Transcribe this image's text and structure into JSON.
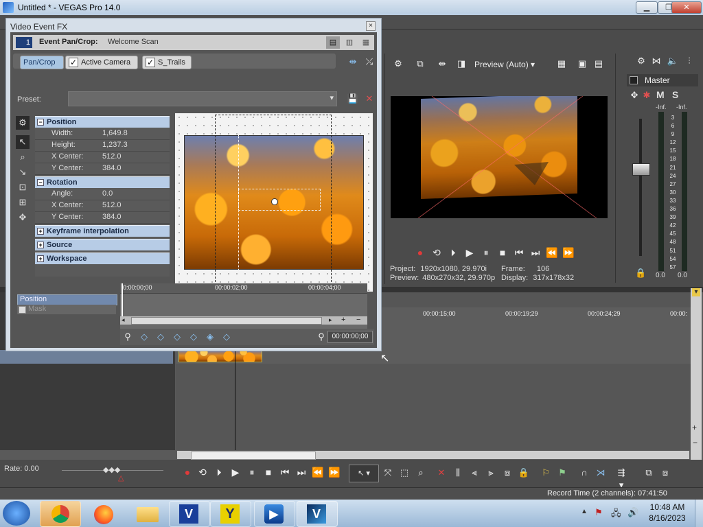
{
  "window": {
    "title": "Untitled * - VEGAS Pro 14.0",
    "min": "▁",
    "max": "❐",
    "close": "✕"
  },
  "dialog": {
    "title": "Video Event FX",
    "close": "×",
    "chain_badge": "1",
    "event_label": "Event Pan/Crop:",
    "event_name": "Welcome Scan",
    "tabs": [
      {
        "label": "Pan/Crop"
      },
      {
        "label": "Active Camera"
      },
      {
        "label": "S_Trails"
      }
    ],
    "preset_label": "Preset:",
    "preset_value": "",
    "sections": {
      "position": {
        "title": "Position",
        "rows": [
          {
            "key": "Width:",
            "value": "1,649.8"
          },
          {
            "key": "Height:",
            "value": "1,237.3"
          },
          {
            "key": "X Center:",
            "value": "512.0"
          },
          {
            "key": "Y Center:",
            "value": "384.0"
          }
        ]
      },
      "rotation": {
        "title": "Rotation",
        "rows": [
          {
            "key": "Angle:",
            "value": "0.0"
          },
          {
            "key": "X Center:",
            "value": "512.0"
          },
          {
            "key": "Y Center:",
            "value": "384.0"
          }
        ]
      },
      "keyframe": {
        "title": "Keyframe interpolation"
      },
      "source": {
        "title": "Source"
      },
      "workspace": {
        "title": "Workspace"
      }
    },
    "timeline": {
      "ticks": [
        "0:00:00;00",
        "00:00:02;00",
        "00:00:04;00"
      ],
      "track_position": "Position",
      "track_mask": "Mask",
      "time_display": "00:00:00;00"
    }
  },
  "preview": {
    "mode": "Preview (Auto)",
    "project_label": "Project:",
    "project_value": "1920x1080, 29.970i",
    "preview_label": "Preview:",
    "preview_value": "480x270x32, 29.970p",
    "frame_label": "Frame:",
    "frame_value": "106",
    "display_label": "Display:",
    "display_value": "317x178x32"
  },
  "mixer": {
    "master_label": "Master",
    "mute": "M",
    "solo": "S",
    "left_inf": "-Inf.",
    "right_inf": "-Inf.",
    "scale": [
      "3",
      "6",
      "9",
      "12",
      "15",
      "18",
      "21",
      "24",
      "27",
      "30",
      "33",
      "36",
      "39",
      "42",
      "45",
      "48",
      "51",
      "54",
      "57"
    ],
    "left_val": "0.0",
    "right_val": "0.0"
  },
  "timeline": {
    "ticks": [
      "00:00:15;00",
      "00:00:19;29",
      "00:00:24;29",
      "00:00:"
    ]
  },
  "status": {
    "rate": "Rate: 0.00",
    "record_time": "Record Time (2 channels): 07:41:50"
  },
  "taskbar": {
    "time": "10:48 AM",
    "date": "8/16/2023",
    "apps": [
      "chrome-icon",
      "firefox-icon",
      "explorer-icon",
      "vegas-suite-icon",
      "vegas-y-icon",
      "media-player-icon",
      "vegas-pro-icon"
    ]
  },
  "colors": {
    "accent": "#a9c6e2",
    "record": "#e03a3a",
    "header_blue": "#b7cce6"
  }
}
